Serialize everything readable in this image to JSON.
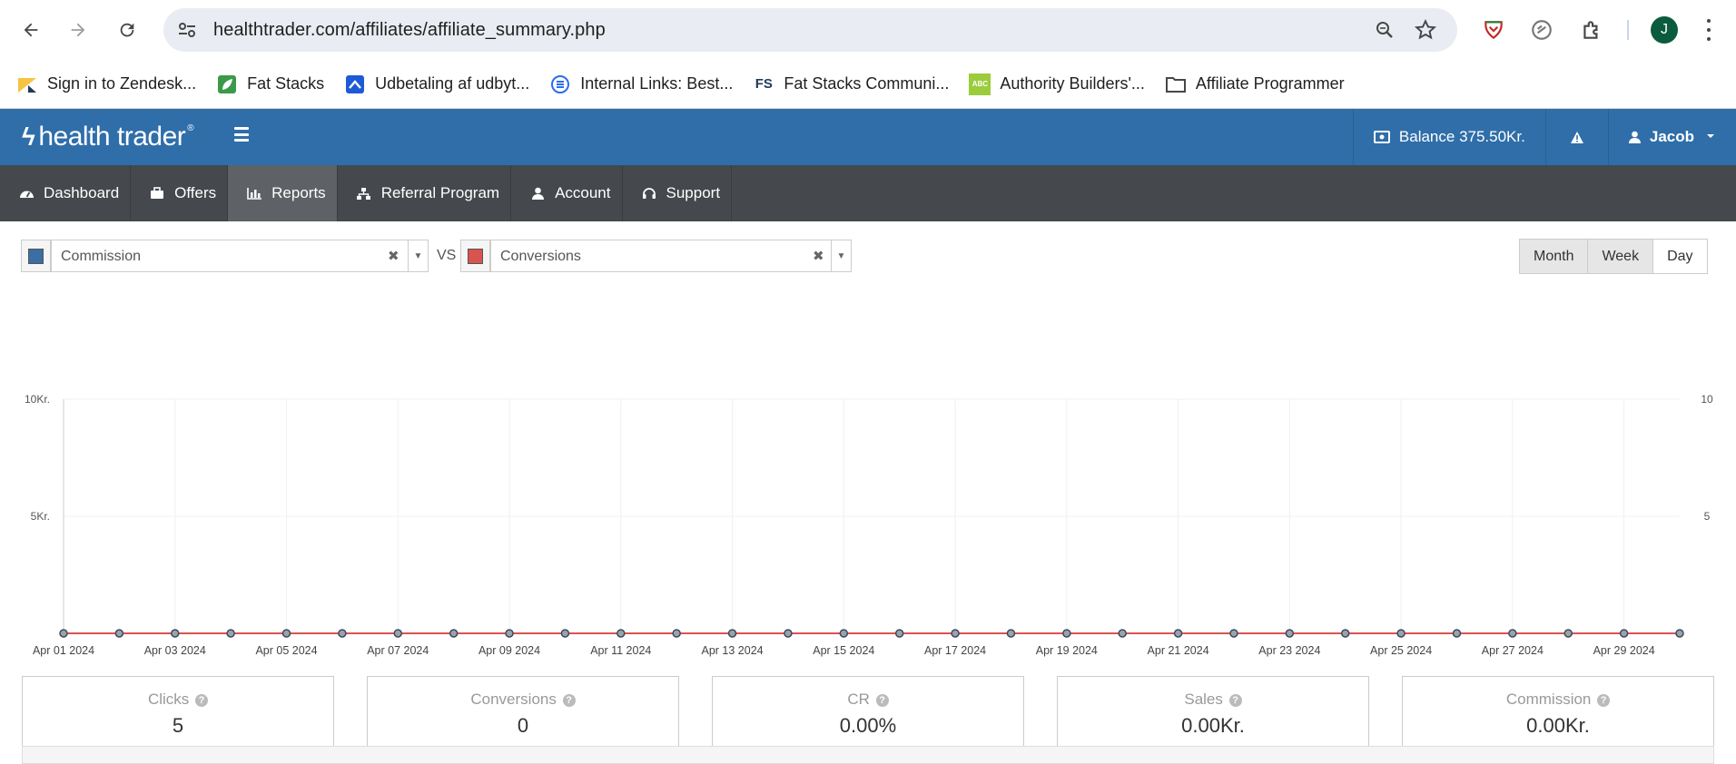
{
  "browser": {
    "url": "healthtrader.com/affiliates/affiliate_summary.php",
    "profile_initial": "J",
    "bookmarks": [
      {
        "label": "Sign in to Zendesk...",
        "icon": "zendesk-icon"
      },
      {
        "label": "Fat Stacks",
        "icon": "fatstacks-leaf-icon"
      },
      {
        "label": "Udbetaling af udbyt...",
        "icon": "udbetaling-icon"
      },
      {
        "label": "Internal Links: Best...",
        "icon": "internal-links-icon"
      },
      {
        "label": "Fat Stacks Communi...",
        "icon": "fs-icon",
        "icon_text": "FS"
      },
      {
        "label": "Authority Builders'...",
        "icon": "authority-builders-icon",
        "icon_text": "ABC"
      },
      {
        "label": "Affiliate Programmer",
        "icon": "folder-icon"
      }
    ]
  },
  "header": {
    "logo_text": "health trader",
    "logo_mark": "ϟ",
    "balance": "Balance 375.50Kr.",
    "user": "Jacob",
    "brand_color": "#2f6ea9"
  },
  "nav": {
    "items": [
      {
        "label": "Dashboard",
        "icon": "dashboard-icon"
      },
      {
        "label": "Offers",
        "icon": "briefcase-icon"
      },
      {
        "label": "Reports",
        "icon": "bar-chart-icon",
        "active": true
      },
      {
        "label": "Referral Program",
        "icon": "sitemap-icon"
      },
      {
        "label": "Account",
        "icon": "user-icon"
      },
      {
        "label": "Support",
        "icon": "headset-icon"
      }
    ]
  },
  "controls": {
    "series1": {
      "value": "Commission",
      "color": "#3a6ea5"
    },
    "vs": "VS",
    "series2": {
      "value": "Conversions",
      "color": "#d9534f"
    },
    "periods": [
      "Month",
      "Week",
      "Day"
    ],
    "selected_period": "Day"
  },
  "chart_data": {
    "type": "line",
    "x": [
      "Apr 01 2024",
      "Apr 02 2024",
      "Apr 03 2024",
      "Apr 04 2024",
      "Apr 05 2024",
      "Apr 06 2024",
      "Apr 07 2024",
      "Apr 08 2024",
      "Apr 09 2024",
      "Apr 10 2024",
      "Apr 11 2024",
      "Apr 12 2024",
      "Apr 13 2024",
      "Apr 14 2024",
      "Apr 15 2024",
      "Apr 16 2024",
      "Apr 17 2024",
      "Apr 18 2024",
      "Apr 19 2024",
      "Apr 20 2024",
      "Apr 21 2024",
      "Apr 22 2024",
      "Apr 23 2024",
      "Apr 24 2024",
      "Apr 25 2024",
      "Apr 26 2024",
      "Apr 27 2024",
      "Apr 28 2024",
      "Apr 29 2024",
      "Apr 30 2024"
    ],
    "x_tick_labels": [
      "Apr 01 2024",
      "Apr 03 2024",
      "Apr 05 2024",
      "Apr 07 2024",
      "Apr 09 2024",
      "Apr 11 2024",
      "Apr 13 2024",
      "Apr 15 2024",
      "Apr 17 2024",
      "Apr 19 2024",
      "Apr 21 2024",
      "Apr 23 2024",
      "Apr 25 2024",
      "Apr 27 2024",
      "Apr 29 2024"
    ],
    "series": [
      {
        "name": "Commission",
        "axis": "left",
        "color": "#3a6ea5",
        "values": [
          0,
          0,
          0,
          0,
          0,
          0,
          0,
          0,
          0,
          0,
          0,
          0,
          0,
          0,
          0,
          0,
          0,
          0,
          0,
          0,
          0,
          0,
          0,
          0,
          0,
          0,
          0,
          0,
          0,
          0
        ]
      },
      {
        "name": "Conversions",
        "axis": "right",
        "color": "#d9534f",
        "values": [
          0,
          0,
          0,
          0,
          0,
          0,
          0,
          0,
          0,
          0,
          0,
          0,
          0,
          0,
          0,
          0,
          0,
          0,
          0,
          0,
          0,
          0,
          0,
          0,
          0,
          0,
          0,
          0,
          0,
          0
        ]
      }
    ],
    "y_left": {
      "ticks": [
        0,
        5000,
        10000
      ],
      "tick_labels": [
        "",
        "5Kr.",
        "10Kr."
      ],
      "ylim": [
        0,
        10000
      ]
    },
    "y_right": {
      "ticks": [
        0,
        5,
        10
      ],
      "tick_labels": [
        "",
        "5",
        "10"
      ],
      "ylim": [
        0,
        10
      ]
    },
    "grid": true
  },
  "stats": [
    {
      "label": "Clicks",
      "value": "5"
    },
    {
      "label": "Conversions",
      "value": "0"
    },
    {
      "label": "CR",
      "value": "0.00%"
    },
    {
      "label": "Sales",
      "value": "0.00Kr."
    },
    {
      "label": "Commission",
      "value": "0.00Kr."
    }
  ]
}
